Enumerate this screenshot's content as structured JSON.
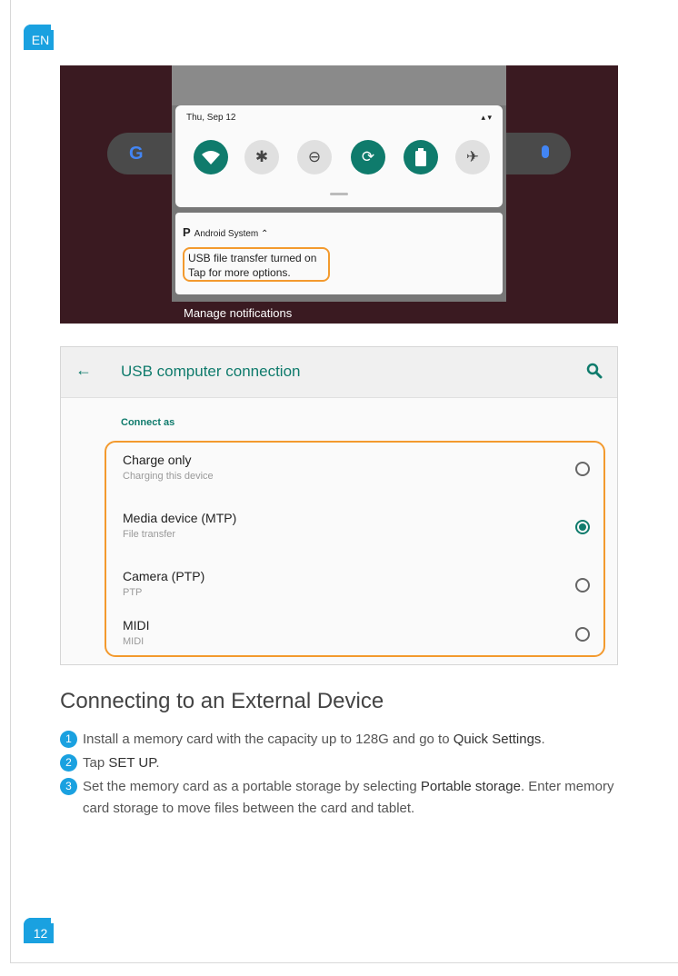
{
  "lang_badge": "EN",
  "page_number": "12",
  "screenshot1": {
    "date": "Thu, Sep 12",
    "notification": {
      "app": "Android System",
      "app_icon_letter": "P",
      "line1": "USB file transfer turned on",
      "line2": "Tap for more options."
    },
    "manage": "Manage notifications"
  },
  "screenshot2": {
    "title": "USB computer connection",
    "section": "Connect as",
    "options": [
      {
        "title": "Charge only",
        "subtitle": "Charging this device",
        "selected": false
      },
      {
        "title": "Media device (MTP)",
        "subtitle": "File transfer",
        "selected": true
      },
      {
        "title": "Camera (PTP)",
        "subtitle": "PTP",
        "selected": false
      },
      {
        "title": "MIDI",
        "subtitle": "MIDI",
        "selected": false
      }
    ]
  },
  "section": {
    "title": "Connecting to an External Device",
    "steps": [
      {
        "num": "1",
        "pre": "Install a memory card with the capacity up to 128G and go to ",
        "bold": "Quick Settings",
        "post": "."
      },
      {
        "num": "2",
        "pre": "Tap ",
        "bold": "SET UP",
        "post": "."
      },
      {
        "num": "3",
        "pre": "Set the memory card as a portable storage by selecting ",
        "bold": "Portable storage",
        "post": ". Enter memory card storage to move files between the card and tablet."
      }
    ]
  },
  "colors": {
    "accent": "#1aa1e0",
    "teal": "#0f7b6c",
    "highlight": "#f39a2e"
  }
}
